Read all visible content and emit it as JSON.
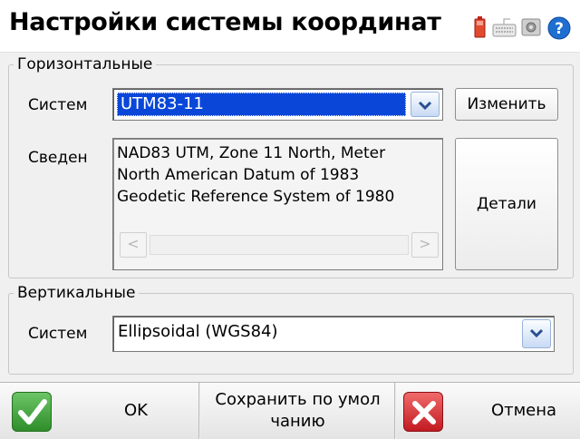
{
  "header": {
    "title": "Настройки системы координат",
    "icons": [
      "battery-icon",
      "keyboard-icon",
      "gear-icon",
      "help-icon"
    ]
  },
  "horizontal": {
    "legend": "Горизонтальные",
    "system_label": "Систем",
    "system_value": "UTM83-11",
    "change_button": "Изменить",
    "info_label": "Сведен",
    "info_lines": [
      "NAD83 UTM, Zone 11 North, Meter",
      "North American Datum of 1983",
      "Geodetic Reference System of 1980"
    ],
    "details_button": "Детали"
  },
  "vertical": {
    "legend": "Вертикальные",
    "system_label": "Систем",
    "system_value": "Ellipsoidal (WGS84)"
  },
  "footer": {
    "ok_label": "OK",
    "save_label_line1": "Сохранить по умол",
    "save_label_line2": "чанию",
    "cancel_label": "Отмена"
  },
  "colors": {
    "accent_red": "#e8303a",
    "selection_blue": "#0a47d8",
    "ok_green": "#3aa335",
    "cancel_red": "#d8222a"
  }
}
